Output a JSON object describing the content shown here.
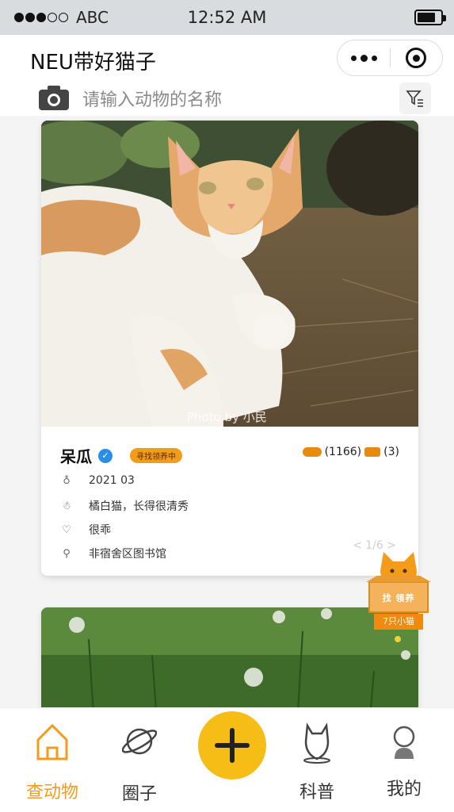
{
  "status_bar": {
    "carrier": "ABC",
    "time": "12:52 AM",
    "battery_icon": "battery-icon"
  },
  "header": {
    "title": "NEU带好猫子",
    "more_icon": "more-icon",
    "close_icon": "target-icon"
  },
  "search": {
    "placeholder": "请输入动物的名称",
    "camera_icon": "camera-icon",
    "filter_icon": "filter-icon"
  },
  "cards": [
    {
      "photo_credit": "Photo by 小民",
      "name": "呆瓜",
      "status_badge": "寻找领养中",
      "likes": "(1166)",
      "comments": "(3)",
      "info": [
        {
          "icon": "birthday-icon",
          "text": "2021 03"
        },
        {
          "icon": "cat-icon",
          "text": "橘白猫，长得很清秀"
        },
        {
          "icon": "heart-icon",
          "text": "很乖"
        },
        {
          "icon": "location-icon",
          "text": "非宿舍区图书馆"
        }
      ],
      "page_indicator": "< 1/6 >"
    },
    {
      "photo": "grass-field"
    }
  ],
  "mascot": {
    "box_text": "找 领养",
    "label": "7只小猫"
  },
  "tabs": [
    {
      "label": "查动物",
      "icon": "house-icon",
      "active": true
    },
    {
      "label": "圈子",
      "icon": "planet-icon",
      "active": false
    },
    {
      "label": "",
      "icon": "add-icon",
      "active": false
    },
    {
      "label": "科普",
      "icon": "cat-location-icon",
      "active": false
    },
    {
      "label": "我的",
      "icon": "user-icon",
      "active": false
    }
  ],
  "colors": {
    "accent": "#f39c1b",
    "add_button": "#f6bd16",
    "status_bar_bg": "#d8dcdf"
  }
}
